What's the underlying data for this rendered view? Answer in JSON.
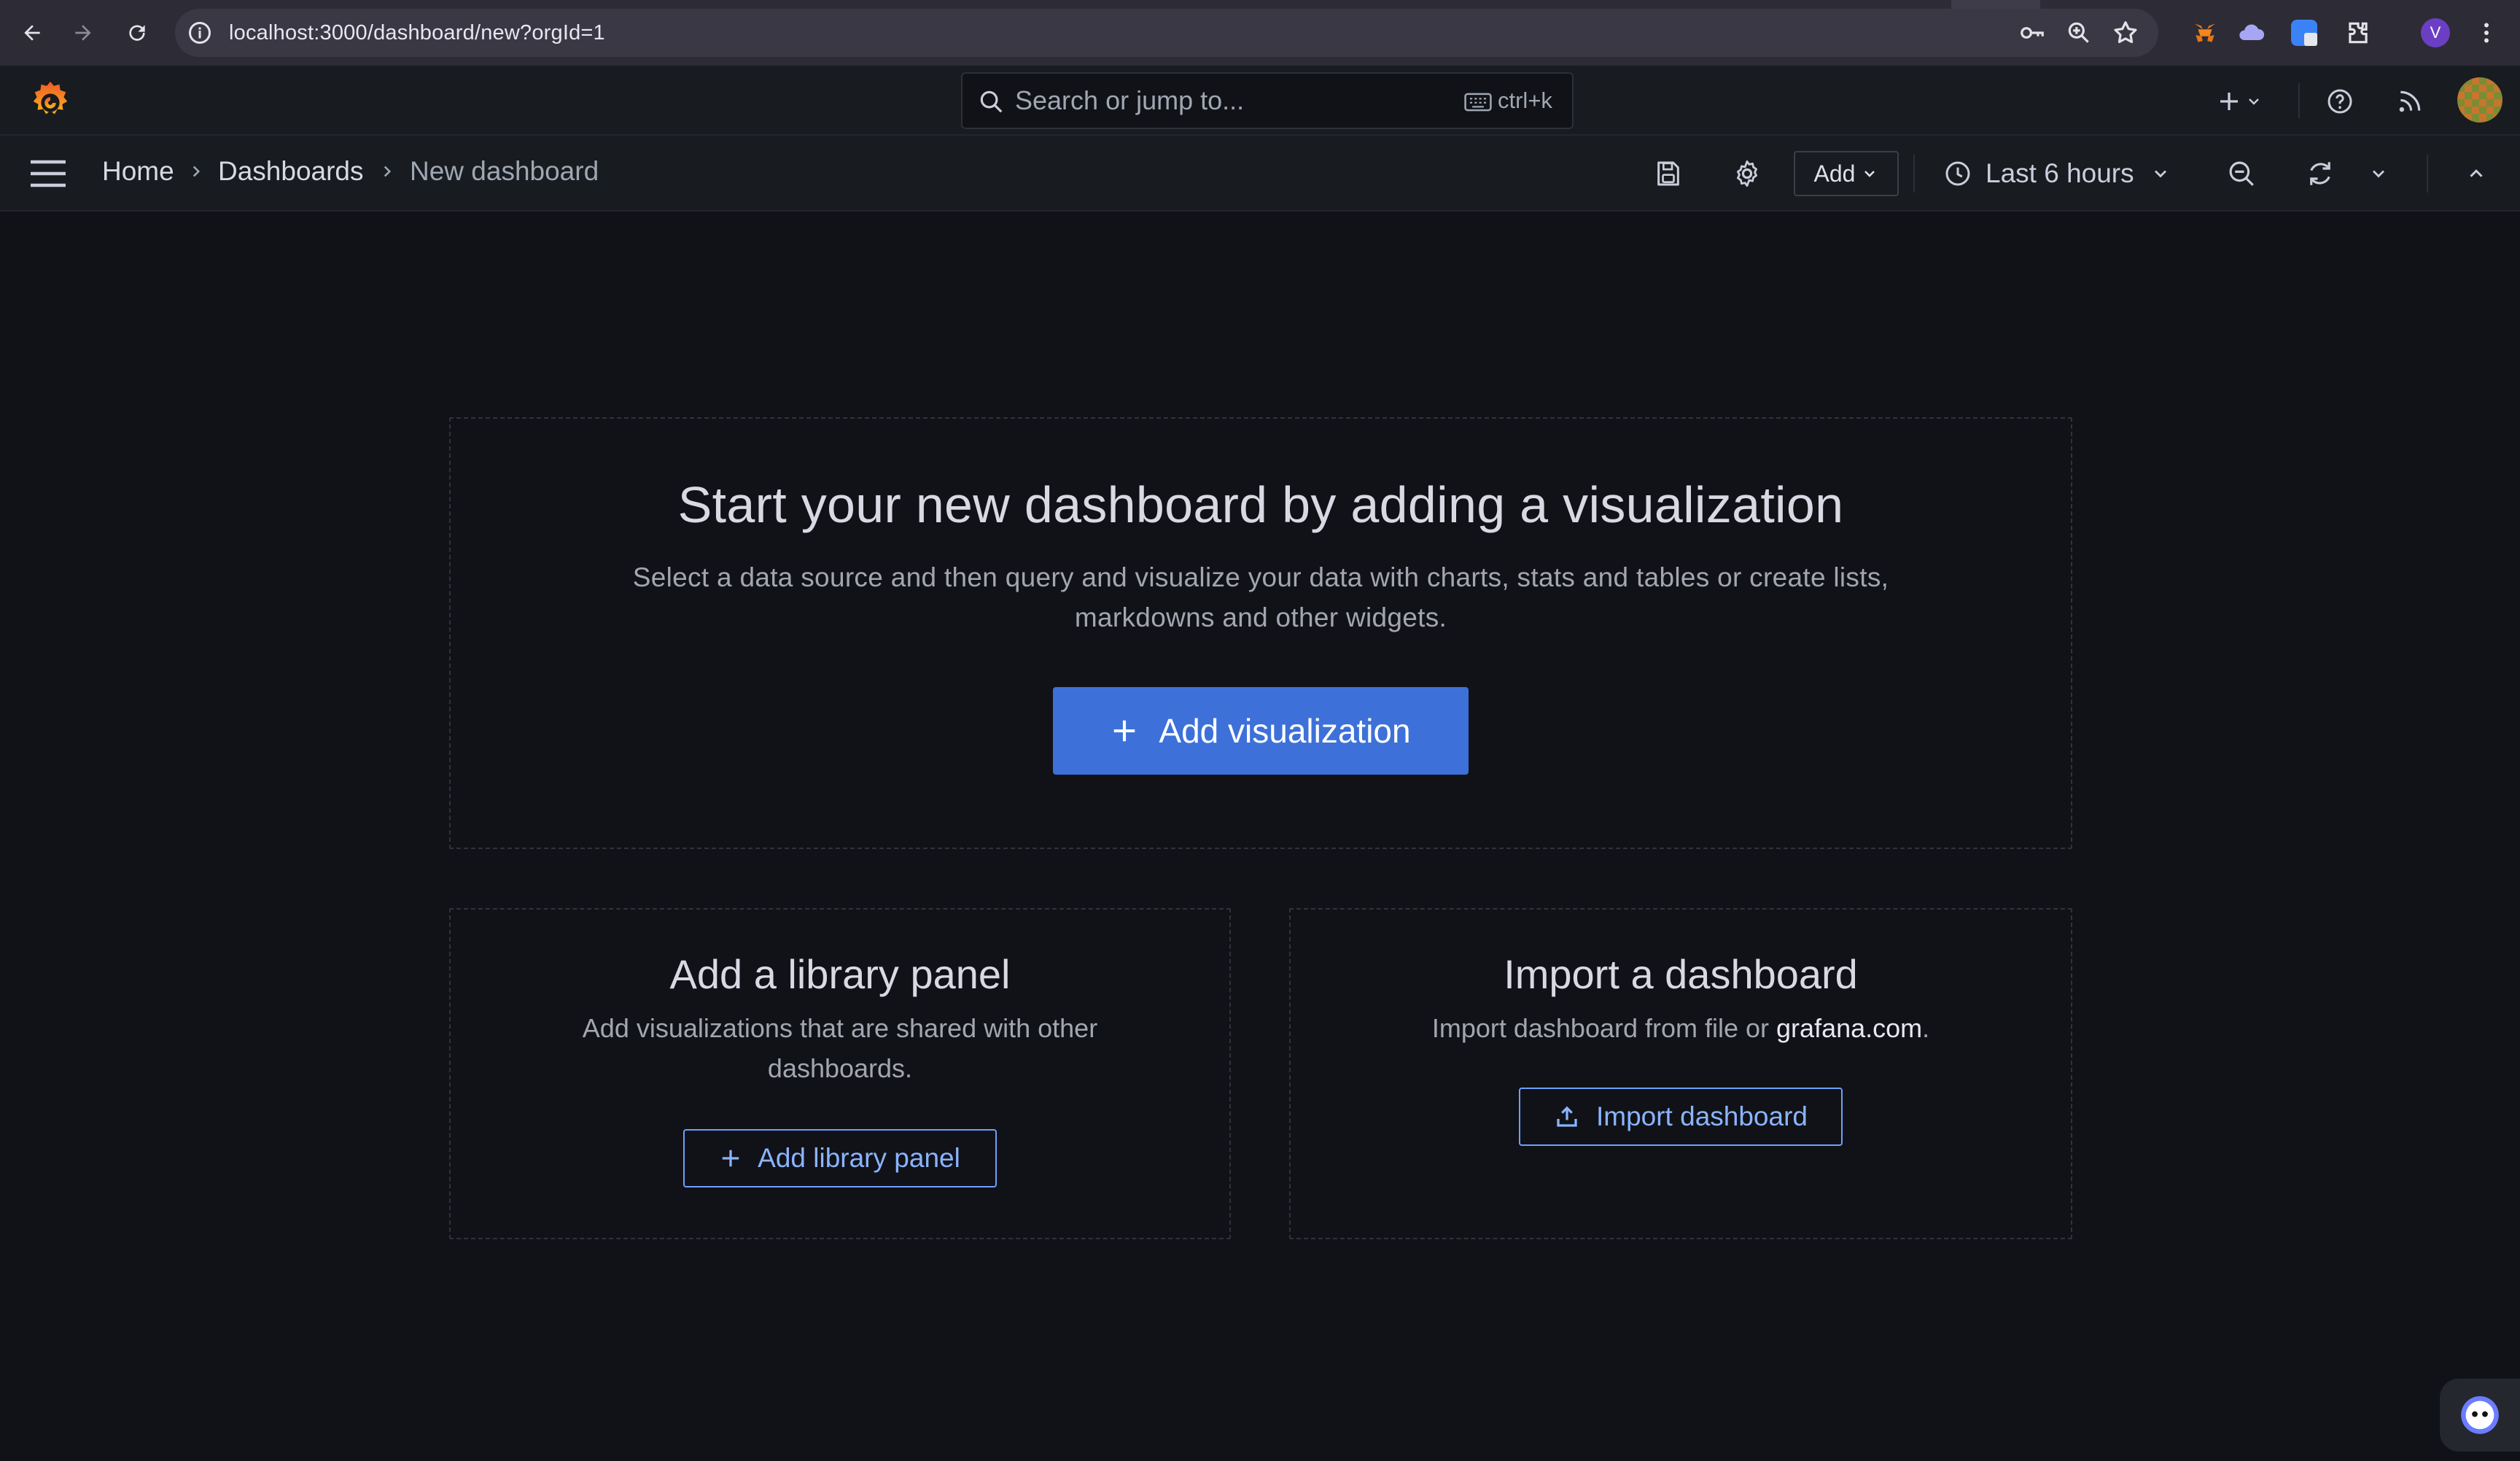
{
  "browser": {
    "url": "localhost:3000/dashboard/new?orgId=1",
    "profile_initial": "V"
  },
  "topbar": {
    "search_placeholder": "Search or jump to...",
    "search_shortcut": "ctrl+k"
  },
  "breadcrumb": {
    "home": "Home",
    "dashboards": "Dashboards",
    "current": "New dashboard"
  },
  "toolbar": {
    "add_label": "Add",
    "time_range": "Last 6 hours"
  },
  "hero": {
    "title": "Start your new dashboard by adding a visualization",
    "description_line1": "Select a data source and then query and visualize your data with charts, stats and tables or create lists,",
    "description_line2": "markdowns and other widgets.",
    "button_label": "Add visualization"
  },
  "library_card": {
    "title": "Add a library panel",
    "description_line1": "Add visualizations that are shared with other",
    "description_line2": "dashboards.",
    "button_label": "Add library panel"
  },
  "import_card": {
    "title": "Import a dashboard",
    "description_prefix": "Import dashboard from file or ",
    "description_link": "grafana.com",
    "description_suffix": ".",
    "button_label": "Import dashboard"
  },
  "colors": {
    "background": "#111217",
    "panel_bar": "#181b1f",
    "primary": "#3d71d9",
    "link": "#8ab4ff"
  }
}
